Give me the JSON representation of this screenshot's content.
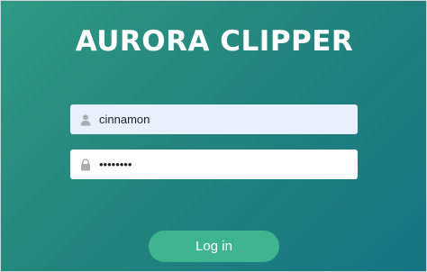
{
  "app": {
    "title": "AURORA CLIPPER"
  },
  "login_form": {
    "username": {
      "value": "cinnamon",
      "icon": "user-icon"
    },
    "password": {
      "value": "••••••••",
      "icon": "lock-icon"
    },
    "submit_label": "Log in"
  },
  "colors": {
    "background_start": "#2f9a84",
    "background_end": "#167483",
    "button": "#3fb58f",
    "autofill_field": "#e8f0fe",
    "title_text": "#ffffff"
  }
}
